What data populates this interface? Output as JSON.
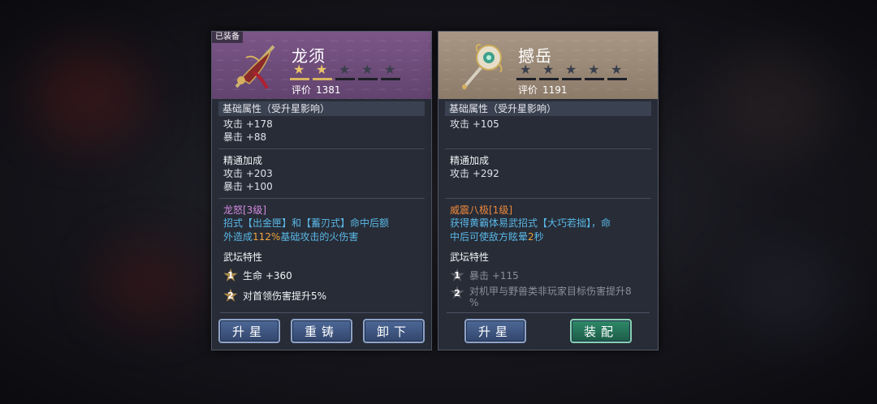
{
  "left_card": {
    "equipped_tag": "已装备",
    "name": "龙须",
    "stars": {
      "filled": 2,
      "total": 5
    },
    "score_label": "评价",
    "score_value": "1381",
    "base_title": "基础属性（受升星影响）",
    "base_stats": [
      "攻击 +178",
      "暴击 +88"
    ],
    "mastery_title": "精通加成",
    "mastery_stats": [
      "攻击 +203",
      "暴击 +100"
    ],
    "skill_name": "龙怒[3级]",
    "skill_desc_1": "招式【出金匣】和【蓄刃式】命中后额",
    "skill_desc_2_pre": "外造成",
    "skill_desc_2_hl": "112%",
    "skill_desc_2_post": "基础攻击的火伤害",
    "trait_title": "武坛特性",
    "traits": [
      {
        "num": "1",
        "text": "生命 +360",
        "active": true
      },
      {
        "num": "2",
        "text": "对首领伤害提升5%",
        "active": true
      }
    ],
    "buttons": [
      "升星",
      "重铸",
      "卸下"
    ]
  },
  "right_card": {
    "name": "撼岳",
    "stars": {
      "filled": 0,
      "total": 5
    },
    "score_label": "评价",
    "score_value": "1191",
    "base_title": "基础属性（受升星影响）",
    "base_stats": [
      "攻击 +105"
    ],
    "mastery_title": "精通加成",
    "mastery_stats": [
      "攻击 +292"
    ],
    "skill_name": "威震八极[1级]",
    "skill_desc_1": "获得黄霸体易武招式【大巧若拙】，命",
    "skill_desc_2_pre": "中后可使敌方眩晕",
    "skill_desc_2_hl": "2",
    "skill_desc_2_post": "秒",
    "trait_title": "武坛特性",
    "traits": [
      {
        "num": "1",
        "text": "暴击 +115",
        "active": false
      },
      {
        "num": "2",
        "text": "对机甲与野兽类非玩家目标伤害提升8",
        "text2": "%",
        "active": false
      }
    ],
    "buttons": [
      "升星",
      "装配"
    ]
  },
  "colors": {
    "left_header": "#6e4b7a",
    "right_header": "#9a8976",
    "skill_name_left": "#d48be0",
    "skill_name_right": "#f08a3c",
    "skill_desc": "#5ab8e6",
    "highlight": "#f0a43c"
  }
}
